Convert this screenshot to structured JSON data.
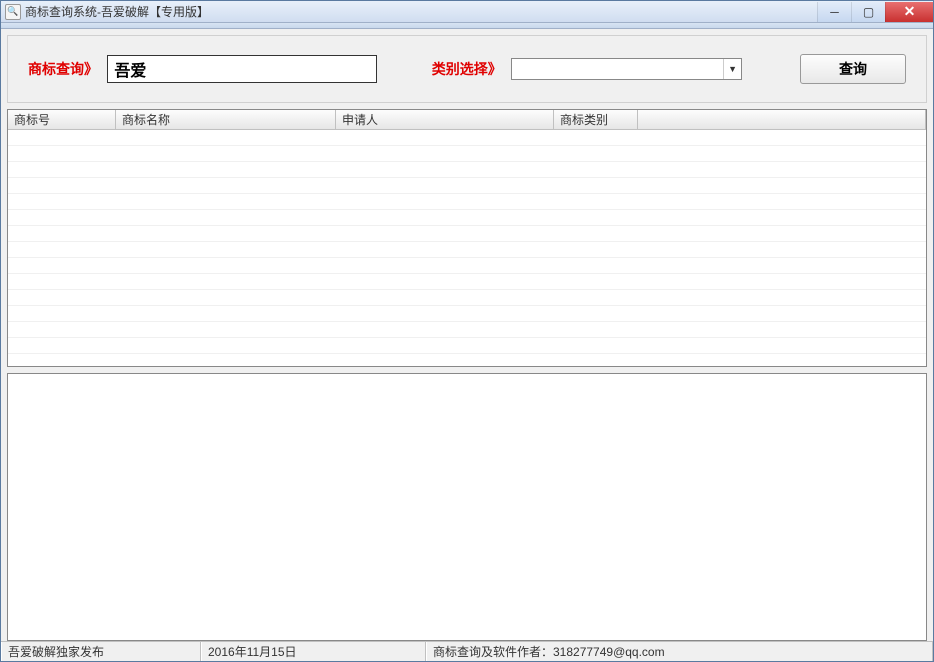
{
  "window": {
    "title": "商标查询系统-吾爱破解【专用版】"
  },
  "search": {
    "label_query": "商标查询》",
    "input_value": "吾爱",
    "label_category": "类别选择》",
    "combo_value": "",
    "button_label": "查询"
  },
  "table": {
    "headers": [
      "商标号",
      "商标名称",
      "申请人",
      "商标类别",
      ""
    ],
    "rows": []
  },
  "statusbar": {
    "publisher": "吾爱破解独家发布",
    "date": "2016年11月15日",
    "author": "商标查询及软件作者：318277749@qq.com"
  }
}
